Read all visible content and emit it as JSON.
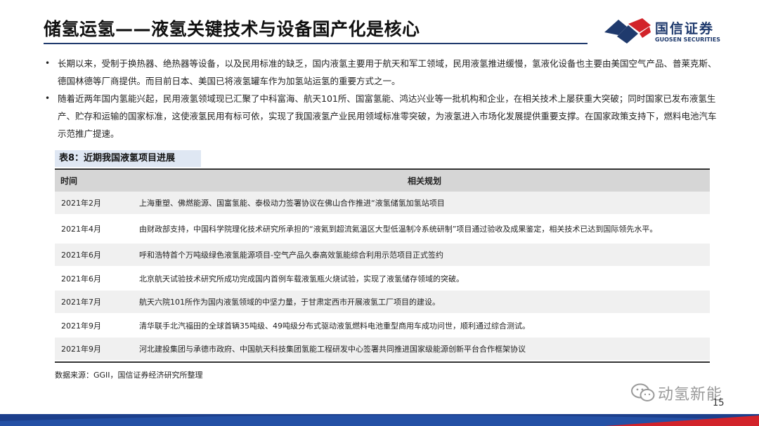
{
  "header": {
    "title": "储氢运氢——液氢关键技术与设备国产化是核心",
    "logo_cn": "国信证券",
    "logo_en": "GUOSEN SECURITIES"
  },
  "bullets": [
    "长期以来，受制于换热器、绝热器等设备，以及民用标准的缺乏，国内液氢主要用于航天和军工领域，民用液氢推进缓慢，氢液化设备也主要由美国空气产品、普莱克斯、德国林德等厂商提供。而目前日本、美国已将液氢罐车作为加氢站运氢的重要方式之一。",
    "随着近两年国内氢能兴起，民用液氢领域现已汇聚了中科富海、航天101所、国富氢能、鸿达兴业等一批机构和企业，在相关技术上屡获重大突破；同时国家已发布液氢生产、贮存和运输的国家标准，这使液氢民用有标可依，实现了我国液氢产业民用领域标准零突破，为液氢进入市场化发展提供重要支撑。在国家政策支持下，燃料电池汽车示范推广提速。"
  ],
  "table": {
    "caption": "表8：近期我国液氢项目进展",
    "headers": [
      "时间",
      "相关规划"
    ],
    "rows": [
      {
        "time": "2021年2月",
        "plan": "上海重塑、佛燃能源、国富氢能、泰极动力签署协议在佛山合作推进“液氢储氢加氢站项目"
      },
      {
        "time": "2021年4月",
        "plan": "由财政部支持，中国科学院理化技术研究所承担的“液氦到超流氦温区大型低温制冷系统研制”项目通过验收及成果鉴定，相关技术已达到国际领先水平。"
      },
      {
        "time": "2021年6月",
        "plan": "呼和浩特首个万吨级绿色液氢能源项目-空气产品久泰高效氢能综合利用示范项目正式签约"
      },
      {
        "time": "2021年6月",
        "plan": "北京航天试验技术研究所成功完成国内首例车载液氢瓶火烧试验，实现了液氢储存领域的突破。"
      },
      {
        "time": "2021年7月",
        "plan": "航天六院101所作为国内液氢领域的中坚力量，于甘肃定西市开展液氢工厂项目的建设。"
      },
      {
        "time": "2021年9月",
        "plan": "清华联手北汽福田的全球首辆35吨级、49吨级分布式驱动液氢燃料电池重型商用车成功问世，顺利通过综合测试。"
      },
      {
        "time": "2021年9月",
        "plan": "河北建投集团与承德市政府、中国航天科技集团氢能工程研发中心签署共同推进国家级能源创新平台合作框架协议"
      }
    ],
    "source": "数据来源：GGII，国信证券经济研究所整理"
  },
  "watermark": "动氢新能",
  "page_number": "15",
  "colors": {
    "brand_navy": "#1f3a6d",
    "brand_red": "#d2232a",
    "footer_blue": "#1c3f8c",
    "caption_bg": "#dfe7f3"
  }
}
